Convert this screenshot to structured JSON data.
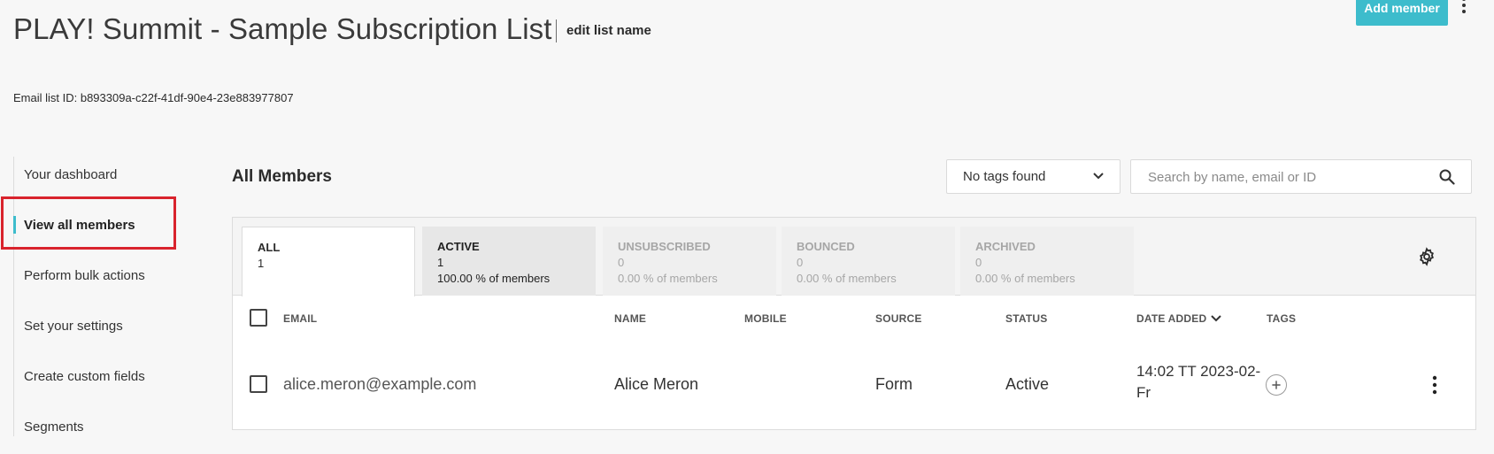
{
  "header": {
    "title": "PLAY! Summit - Sample Subscription List",
    "edit_label": "edit list name",
    "add_member_label": "Add member",
    "list_id_label": "Email list ID: b893309a-c22f-41df-90e4-23e883977807"
  },
  "sidebar": {
    "items": [
      {
        "label": "Your dashboard",
        "active": false
      },
      {
        "label": "View all members",
        "active": true
      },
      {
        "label": "Perform bulk actions",
        "active": false
      },
      {
        "label": "Set your settings",
        "active": false
      },
      {
        "label": "Create custom fields",
        "active": false
      },
      {
        "label": "Segments",
        "active": false
      }
    ]
  },
  "main": {
    "title": "All Members",
    "tags_filter": {
      "selected": "No tags found"
    },
    "search": {
      "placeholder": "Search by name, email or ID",
      "value": ""
    },
    "tabs": [
      {
        "label": "ALL",
        "count": "1",
        "percent": ""
      },
      {
        "label": "ACTIVE",
        "count": "1",
        "percent": "100.00 % of members"
      },
      {
        "label": "UNSUBSCRIBED",
        "count": "0",
        "percent": "0.00 % of members"
      },
      {
        "label": "BOUNCED",
        "count": "0",
        "percent": "0.00 % of members"
      },
      {
        "label": "ARCHIVED",
        "count": "0",
        "percent": "0.00 % of members"
      }
    ],
    "table": {
      "columns": [
        "EMAIL",
        "NAME",
        "MOBILE",
        "SOURCE",
        "STATUS",
        "DATE ADDED",
        "TAGS"
      ],
      "sorted_column": "DATE ADDED",
      "rows": [
        {
          "email": "alice.meron@example.com",
          "name": "Alice Meron",
          "mobile": "",
          "source": "Form",
          "status": "Active",
          "date_added": "14:02 TT 2023-02-Fr",
          "tags": []
        }
      ]
    }
  },
  "colors": {
    "accent": "#3dbccc",
    "highlight": "#d9232d",
    "background": "#f7f7f7"
  },
  "icons": [
    "kebab-icon",
    "chevron-down-icon",
    "search-icon",
    "gear-icon",
    "plus-icon"
  ]
}
